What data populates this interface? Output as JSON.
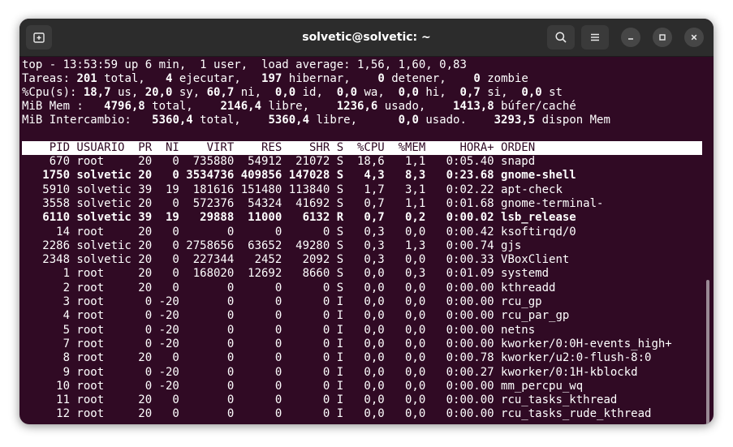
{
  "window": {
    "title": "solvetic@solvetic: ~"
  },
  "icons": {
    "new_tab": "new-tab-icon",
    "search": "search-icon",
    "menu": "hamburger-menu-icon",
    "minimize": "minimize-icon",
    "maximize": "maximize-icon",
    "close": "close-icon"
  },
  "colors": {
    "terminal_bg": "#300a24",
    "titlebar_bg": "#2c2c2c",
    "text": "#ffffff"
  },
  "summary": {
    "line1": "top - 13:53:59 up 6 min,  1 user,  load average: 1,56, 1,60, 0,83",
    "line2": [
      {
        "t": "Tareas: ",
        "b": false
      },
      {
        "t": "201",
        "b": true
      },
      {
        "t": " total,   ",
        "b": false
      },
      {
        "t": "4",
        "b": true
      },
      {
        "t": " ejecutar,   ",
        "b": false
      },
      {
        "t": "197",
        "b": true
      },
      {
        "t": " hibernar,    ",
        "b": false
      },
      {
        "t": "0",
        "b": true
      },
      {
        "t": " detener,    ",
        "b": false
      },
      {
        "t": "0",
        "b": true
      },
      {
        "t": " zombie",
        "b": false
      }
    ],
    "line3": [
      {
        "t": "%Cpu(s): ",
        "b": false
      },
      {
        "t": "18,7",
        "b": true
      },
      {
        "t": " us, ",
        "b": false
      },
      {
        "t": "20,0",
        "b": true
      },
      {
        "t": " sy, ",
        "b": false
      },
      {
        "t": "60,7",
        "b": true
      },
      {
        "t": " ni,  ",
        "b": false
      },
      {
        "t": "0,0",
        "b": true
      },
      {
        "t": " id,  ",
        "b": false
      },
      {
        "t": "0,0",
        "b": true
      },
      {
        "t": " wa,  ",
        "b": false
      },
      {
        "t": "0,0",
        "b": true
      },
      {
        "t": " hi,  ",
        "b": false
      },
      {
        "t": "0,7",
        "b": true
      },
      {
        "t": " si,  ",
        "b": false
      },
      {
        "t": "0,0",
        "b": true
      },
      {
        "t": " st",
        "b": false
      }
    ],
    "line4": [
      {
        "t": "MiB Mem :   ",
        "b": false
      },
      {
        "t": "4796,8",
        "b": true
      },
      {
        "t": " total,    ",
        "b": false
      },
      {
        "t": "2146,4",
        "b": true
      },
      {
        "t": " libre,    ",
        "b": false
      },
      {
        "t": "1236,6",
        "b": true
      },
      {
        "t": " usado,    ",
        "b": false
      },
      {
        "t": "1413,8",
        "b": true
      },
      {
        "t": " búfer/caché",
        "b": false
      }
    ],
    "line5": [
      {
        "t": "MiB Intercambio:   ",
        "b": false
      },
      {
        "t": "5360,4",
        "b": true
      },
      {
        "t": " total,    ",
        "b": false
      },
      {
        "t": "5360,4",
        "b": true
      },
      {
        "t": " libre,      ",
        "b": false
      },
      {
        "t": "0,0",
        "b": true
      },
      {
        "t": " usado.    ",
        "b": false
      },
      {
        "t": "3293,5",
        "b": true
      },
      {
        "t": " dispon Mem",
        "b": false
      }
    ]
  },
  "table": {
    "columns": [
      "PID",
      "USUARIO",
      "PR",
      "NI",
      "VIRT",
      "RES",
      "SHR",
      "S",
      "%CPU",
      "%MEM",
      "HORA+",
      "ORDEN"
    ],
    "rows": [
      {
        "pid": "670",
        "user": "root",
        "pr": "20",
        "ni": "0",
        "virt": "735880",
        "res": "54912",
        "shr": "21072",
        "s": "S",
        "cpu": "18,6",
        "mem": "1,1",
        "time": "0:05.40",
        "cmd": "snapd",
        "bold": false
      },
      {
        "pid": "1750",
        "user": "solvetic",
        "pr": "20",
        "ni": "0",
        "virt": "3534736",
        "res": "409856",
        "shr": "147028",
        "s": "S",
        "cpu": "4,3",
        "mem": "8,3",
        "time": "0:23.68",
        "cmd": "gnome-shell",
        "bold": true
      },
      {
        "pid": "5910",
        "user": "solvetic",
        "pr": "39",
        "ni": "19",
        "virt": "181616",
        "res": "151480",
        "shr": "113840",
        "s": "S",
        "cpu": "1,7",
        "mem": "3,1",
        "time": "0:02.22",
        "cmd": "apt-check",
        "bold": false
      },
      {
        "pid": "3558",
        "user": "solvetic",
        "pr": "20",
        "ni": "0",
        "virt": "572376",
        "res": "54324",
        "shr": "41692",
        "s": "S",
        "cpu": "0,7",
        "mem": "1,1",
        "time": "0:01.68",
        "cmd": "gnome-terminal-",
        "bold": false
      },
      {
        "pid": "6110",
        "user": "solvetic",
        "pr": "39",
        "ni": "19",
        "virt": "29888",
        "res": "11000",
        "shr": "6132",
        "s": "R",
        "cpu": "0,7",
        "mem": "0,2",
        "time": "0:00.02",
        "cmd": "lsb_release",
        "bold": true
      },
      {
        "pid": "14",
        "user": "root",
        "pr": "20",
        "ni": "0",
        "virt": "0",
        "res": "0",
        "shr": "0",
        "s": "S",
        "cpu": "0,3",
        "mem": "0,0",
        "time": "0:00.42",
        "cmd": "ksoftirqd/0",
        "bold": false
      },
      {
        "pid": "2286",
        "user": "solvetic",
        "pr": "20",
        "ni": "0",
        "virt": "2758656",
        "res": "63652",
        "shr": "49280",
        "s": "S",
        "cpu": "0,3",
        "mem": "1,3",
        "time": "0:00.74",
        "cmd": "gjs",
        "bold": false
      },
      {
        "pid": "2348",
        "user": "solvetic",
        "pr": "20",
        "ni": "0",
        "virt": "227344",
        "res": "2452",
        "shr": "2092",
        "s": "S",
        "cpu": "0,3",
        "mem": "0,0",
        "time": "0:00.33",
        "cmd": "VBoxClient",
        "bold": false
      },
      {
        "pid": "1",
        "user": "root",
        "pr": "20",
        "ni": "0",
        "virt": "168020",
        "res": "12692",
        "shr": "8660",
        "s": "S",
        "cpu": "0,0",
        "mem": "0,3",
        "time": "0:01.09",
        "cmd": "systemd",
        "bold": false
      },
      {
        "pid": "2",
        "user": "root",
        "pr": "20",
        "ni": "0",
        "virt": "0",
        "res": "0",
        "shr": "0",
        "s": "S",
        "cpu": "0,0",
        "mem": "0,0",
        "time": "0:00.00",
        "cmd": "kthreadd",
        "bold": false
      },
      {
        "pid": "3",
        "user": "root",
        "pr": "0",
        "ni": "-20",
        "virt": "0",
        "res": "0",
        "shr": "0",
        "s": "I",
        "cpu": "0,0",
        "mem": "0,0",
        "time": "0:00.00",
        "cmd": "rcu_gp",
        "bold": false
      },
      {
        "pid": "4",
        "user": "root",
        "pr": "0",
        "ni": "-20",
        "virt": "0",
        "res": "0",
        "shr": "0",
        "s": "I",
        "cpu": "0,0",
        "mem": "0,0",
        "time": "0:00.00",
        "cmd": "rcu_par_gp",
        "bold": false
      },
      {
        "pid": "5",
        "user": "root",
        "pr": "0",
        "ni": "-20",
        "virt": "0",
        "res": "0",
        "shr": "0",
        "s": "I",
        "cpu": "0,0",
        "mem": "0,0",
        "time": "0:00.00",
        "cmd": "netns",
        "bold": false
      },
      {
        "pid": "7",
        "user": "root",
        "pr": "0",
        "ni": "-20",
        "virt": "0",
        "res": "0",
        "shr": "0",
        "s": "I",
        "cpu": "0,0",
        "mem": "0,0",
        "time": "0:00.00",
        "cmd": "kworker/0:0H-events_high+",
        "bold": false
      },
      {
        "pid": "8",
        "user": "root",
        "pr": "20",
        "ni": "0",
        "virt": "0",
        "res": "0",
        "shr": "0",
        "s": "I",
        "cpu": "0,0",
        "mem": "0,0",
        "time": "0:00.78",
        "cmd": "kworker/u2:0-flush-8:0",
        "bold": false
      },
      {
        "pid": "9",
        "user": "root",
        "pr": "0",
        "ni": "-20",
        "virt": "0",
        "res": "0",
        "shr": "0",
        "s": "I",
        "cpu": "0,0",
        "mem": "0,0",
        "time": "0:00.27",
        "cmd": "kworker/0:1H-kblockd",
        "bold": false
      },
      {
        "pid": "10",
        "user": "root",
        "pr": "0",
        "ni": "-20",
        "virt": "0",
        "res": "0",
        "shr": "0",
        "s": "I",
        "cpu": "0,0",
        "mem": "0,0",
        "time": "0:00.00",
        "cmd": "mm_percpu_wq",
        "bold": false
      },
      {
        "pid": "11",
        "user": "root",
        "pr": "20",
        "ni": "0",
        "virt": "0",
        "res": "0",
        "shr": "0",
        "s": "I",
        "cpu": "0,0",
        "mem": "0,0",
        "time": "0:00.00",
        "cmd": "rcu_tasks_kthread",
        "bold": false
      },
      {
        "pid": "12",
        "user": "root",
        "pr": "20",
        "ni": "0",
        "virt": "0",
        "res": "0",
        "shr": "0",
        "s": "I",
        "cpu": "0,0",
        "mem": "0,0",
        "time": "0:00.00",
        "cmd": "rcu_tasks_rude_kthread",
        "bold": false
      }
    ]
  }
}
